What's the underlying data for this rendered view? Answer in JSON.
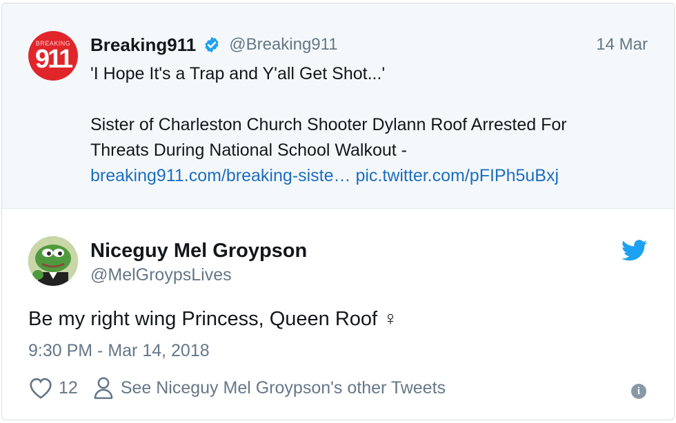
{
  "parent_tweet": {
    "avatar_text_small": "BREAKING",
    "avatar_text_big": "911",
    "name": "Breaking911",
    "handle": "@Breaking911",
    "date": "14 Mar",
    "line1": "'I Hope It's a Trap and Y'all Get Shot...'",
    "line2": "Sister of Charleston Church Shooter Dylann Roof Arrested For",
    "line3": "Threats During National School Walkout -",
    "link1": "breaking911.com/breaking-siste…",
    "link2": "pic.twitter.com/pFIPh5uBxj"
  },
  "tweet": {
    "name": "Niceguy Mel Groypson",
    "handle": "@MelGroypsLives",
    "text": "Be my right wing Princess, Queen Roof ♀",
    "timestamp": "9:30 PM - Mar 14, 2018",
    "like_count": "12",
    "other_tweets_label": "See Niceguy Mel Groypson's other Tweets",
    "info_symbol": "i"
  },
  "colors": {
    "link": "#1b6ec2",
    "twitter_blue": "#1da1f2",
    "muted": "#657786",
    "parent_bg": "#f5f8fa"
  },
  "icons": [
    "verified-badge-icon",
    "twitter-bird-icon",
    "heart-icon",
    "person-icon",
    "info-icon"
  ]
}
